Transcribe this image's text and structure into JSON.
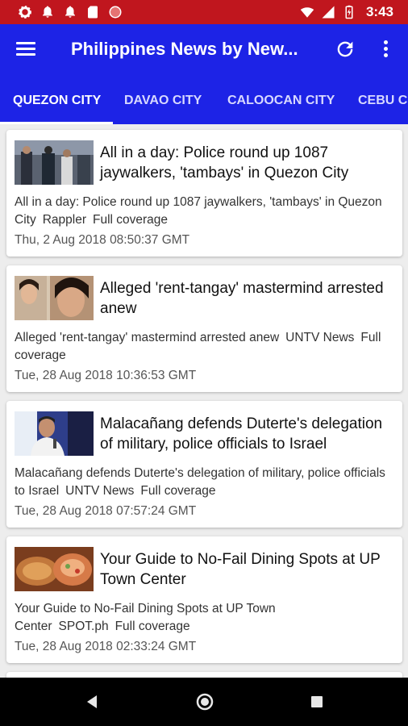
{
  "status_bar": {
    "time": "3:43"
  },
  "app_bar": {
    "title": "Philippines News by New..."
  },
  "tabs": [
    "QUEZON CITY",
    "DAVAO CITY",
    "CALOOCAN CITY",
    "CEBU CI"
  ],
  "articles": [
    {
      "title": "All in a day: Police round up 1087 jaywalkers, 'tambays' in Quezon City",
      "description": "All in a day: Police round up 1087 jaywalkers, 'tambays' in Quezon City",
      "source": "Rappler",
      "coverage": "Full coverage",
      "date": "Thu, 2 Aug 2018 08:50:37 GMT"
    },
    {
      "title": "Alleged 'rent-tangay' mastermind arrested anew",
      "description": "Alleged 'rent-tangay' mastermind arrested anew",
      "source": "UNTV News",
      "coverage": "Full coverage",
      "date": "Tue, 28 Aug 2018 10:36:53 GMT"
    },
    {
      "title": "Malacañang defends Duterte's delegation of military, police officials to Israel",
      "description": "Malacañang defends Duterte's delegation of military, police officials to Israel",
      "source": "UNTV News",
      "coverage": "Full coverage",
      "date": "Tue, 28 Aug 2018 07:57:24 GMT"
    },
    {
      "title": "Your Guide to No-Fail Dining Spots at UP Town Center",
      "description": "Your Guide to No-Fail Dining Spots at UP Town Center",
      "source": "SPOT.ph",
      "coverage": "Full coverage",
      "date": "Tue, 28 Aug 2018 02:33:24 GMT"
    }
  ],
  "colors": {
    "status_bar": "#c0161e",
    "app_bar": "#1d23e6"
  }
}
